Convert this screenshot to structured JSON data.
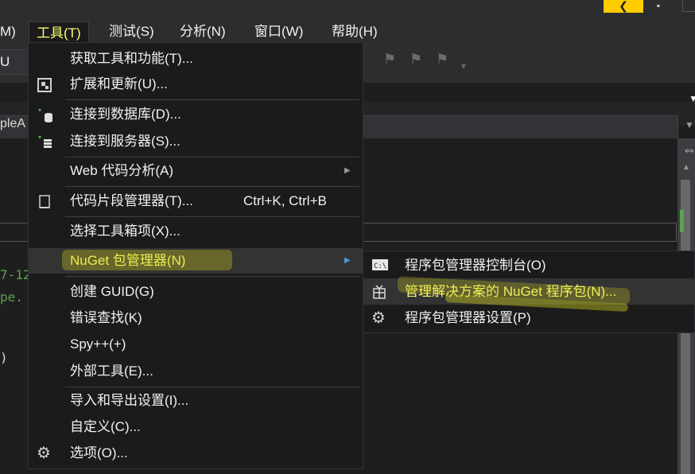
{
  "titlebar": {
    "accent_glyph": "❮",
    "pin_glyph": "▪"
  },
  "menubar": {
    "items": [
      {
        "label": "M)"
      },
      {
        "label": "工具(T)"
      },
      {
        "label": "测试(S)"
      },
      {
        "label": "分析(N)"
      },
      {
        "label": "窗口(W)"
      },
      {
        "label": "帮助(H)"
      }
    ]
  },
  "toolbar": {
    "config_combo": "U",
    "split_glyph": "⇔"
  },
  "editor": {
    "file_combo_text": "pleA",
    "code_lines": [
      "7-12",
      "pe. S",
      ")"
    ]
  },
  "tools_menu": {
    "items": [
      {
        "label": "获取工具和功能(T)...",
        "icon": "none"
      },
      {
        "label": "扩展和更新(U)...",
        "icon": "extensions-icon"
      },
      {
        "label": "连接到数据库(D)...",
        "icon": "database-connect-icon"
      },
      {
        "label": "连接到服务器(S)...",
        "icon": "server-connect-icon"
      },
      {
        "label": "Web 代码分析(A)",
        "icon": "none",
        "arrow": "▶"
      },
      {
        "label": "代码片段管理器(T)...",
        "icon": "snippet-icon",
        "shortcut": "Ctrl+K, Ctrl+B"
      },
      {
        "label": "选择工具箱项(X)...",
        "icon": "none"
      },
      {
        "label": "NuGet 包管理器(N)",
        "icon": "none",
        "arrow": "▶"
      },
      {
        "label": "创建 GUID(G)",
        "icon": "none"
      },
      {
        "label": "错误查找(K)",
        "icon": "none"
      },
      {
        "label": "Spy++(+)",
        "icon": "none"
      },
      {
        "label": "外部工具(E)...",
        "icon": "none"
      },
      {
        "label": "导入和导出设置(I)...",
        "icon": "none"
      },
      {
        "label": "自定义(C)...",
        "icon": "none"
      },
      {
        "label": "选项(O)...",
        "icon": "gear-icon"
      }
    ]
  },
  "nuget_submenu": {
    "items": [
      {
        "label": "程序包管理器控制台(O)",
        "icon": "console-icon"
      },
      {
        "label": "管理解决方案的 NuGet 程序包(N)...",
        "icon": "package-icon"
      },
      {
        "label": "程序包管理器设置(P)",
        "icon": "gear-icon"
      }
    ]
  },
  "colors": {
    "menu_bg": "#1b1b1c",
    "highlight_text": "#ffff6e",
    "hover_bg": "#333334",
    "title_accent": "#ffcc00"
  }
}
